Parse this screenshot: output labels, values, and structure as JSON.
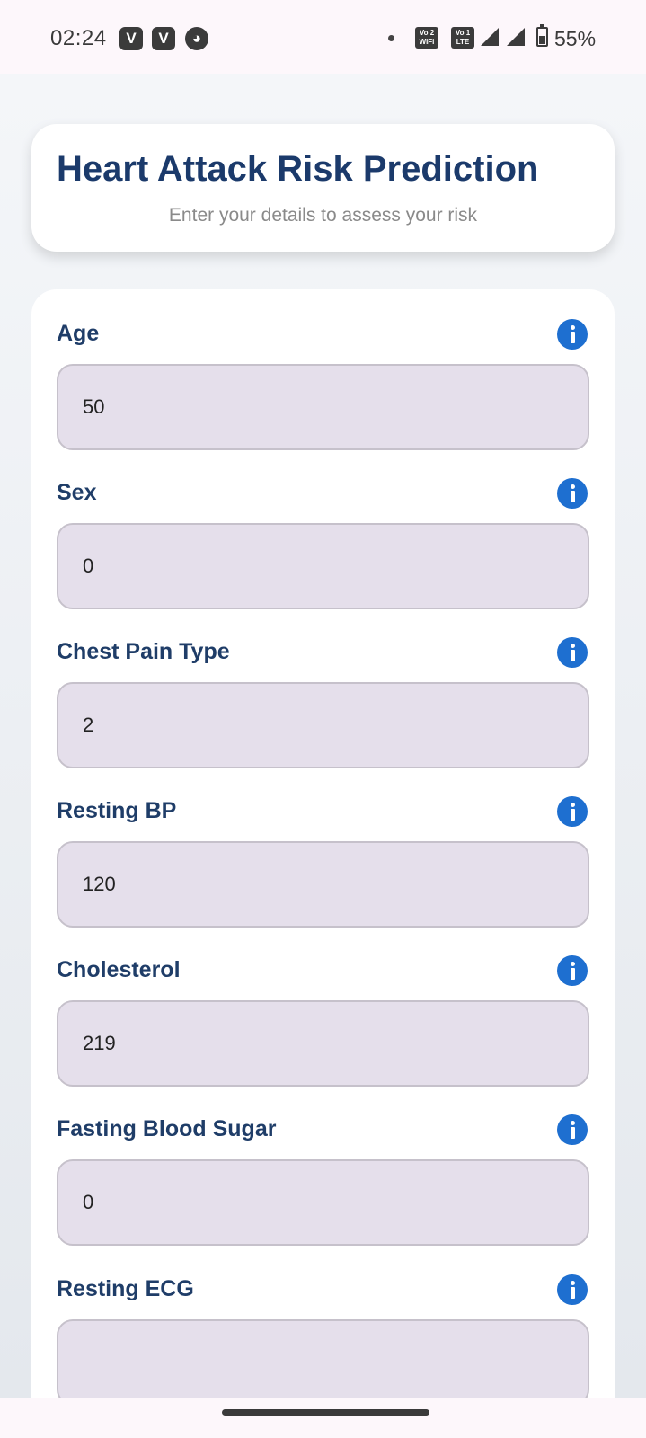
{
  "status_bar": {
    "time": "02:24",
    "notification_icons": [
      "V",
      "V",
      "◕"
    ],
    "wifi_badge": "Vo 2\nWiFi",
    "lte_badge": "Vo 1\nLTE",
    "battery_level_percent": 55,
    "battery_text": "55%"
  },
  "header": {
    "title": "Heart Attack Risk Prediction",
    "subtitle": "Enter your details to assess your risk"
  },
  "form": {
    "fields": [
      {
        "label": "Age",
        "value": "50"
      },
      {
        "label": "Sex",
        "value": "0"
      },
      {
        "label": "Chest Pain Type",
        "value": "2"
      },
      {
        "label": "Resting BP",
        "value": "120"
      },
      {
        "label": "Cholesterol",
        "value": "219"
      },
      {
        "label": "Fasting Blood Sugar",
        "value": "0"
      },
      {
        "label": "Resting ECG",
        "value": ""
      }
    ]
  },
  "colors": {
    "title": "#1b3a6b",
    "info_icon": "#1e6fd0",
    "input_background": "#e5dfeb"
  }
}
